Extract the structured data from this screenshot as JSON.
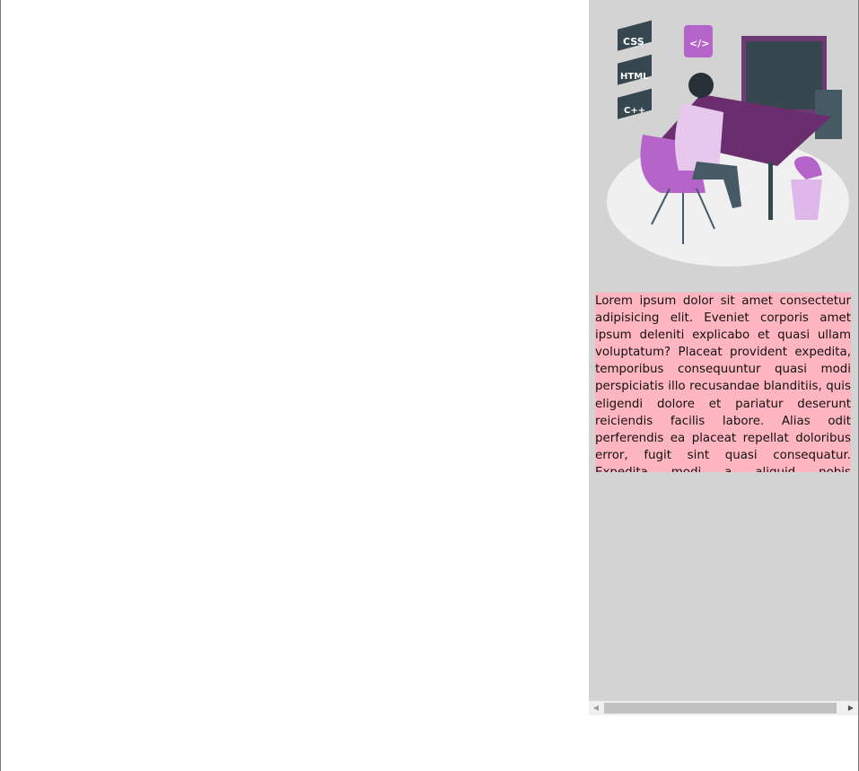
{
  "illustration": {
    "labels": [
      "CSS",
      "HTML",
      "C++",
      "</>"
    ]
  },
  "content": {
    "paragraph": "Lorem ipsum dolor sit amet consectetur adipisicing elit. Eveniet corporis amet ipsum deleniti explicabo et quasi ullam voluptatum? Placeat provident expedita, temporibus consequuntur quasi modi perspiciatis illo recusandae blanditiis, quis eligendi dolore et pariatur deserunt reiciendis facilis labore. Alias odit perferendis ea placeat repellat doloribus error, fugit sint quasi consequatur. Expedita modi a aliquid nobis consequuntur esse"
  },
  "colors": {
    "panel": "#d3d3d3",
    "text_bg": "#ffb6c1",
    "accent": "#b565c9"
  }
}
